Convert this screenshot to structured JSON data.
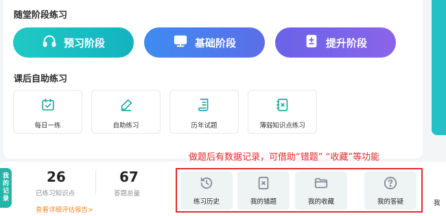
{
  "practice": {
    "section_title": "随堂阶段练习",
    "stages": [
      {
        "label": "预习阶段",
        "icon": "headphones-icon",
        "color_from": "#1fc9c4",
        "color_to": "#14b3bf"
      },
      {
        "label": "基础阶段",
        "icon": "monitor-icon",
        "color_from": "#3e8bf0",
        "color_to": "#5b6ee8"
      },
      {
        "label": "提升阶段",
        "icon": "badge-icon",
        "color_from": "#6a63e8",
        "color_to": "#8a64e9"
      }
    ]
  },
  "after_class": {
    "section_title": "课后自助练习",
    "tiles": [
      {
        "label": "每日一练",
        "icon": "calendar-check-icon"
      },
      {
        "label": "自助练习",
        "icon": "pencil-icon"
      },
      {
        "label": "历年试题",
        "icon": "scroll-icon"
      },
      {
        "label": "薄弱知识点练习",
        "icon": "notebook-x-icon"
      }
    ]
  },
  "records": {
    "tab_label": "我的记录",
    "stats": [
      {
        "value": "26",
        "label": "已练习知识点"
      },
      {
        "value": "67",
        "label": "答题总量"
      }
    ],
    "report_link": "查看详细评估报告>",
    "hint": "做题后有数据记录，可借助“错题”  “收藏”等功能",
    "items": [
      {
        "label": "练习历史",
        "icon": "history-icon"
      },
      {
        "label": "我的错题",
        "icon": "wrong-questions-icon"
      },
      {
        "label": "我的收藏",
        "icon": "folder-icon"
      },
      {
        "label": "我的答疑",
        "icon": "question-icon"
      }
    ],
    "partial_item": "我"
  },
  "colors": {
    "accent_teal": "#23c0c5",
    "icon_teal": "#1aa8a0",
    "highlight_red": "#e8262b",
    "link_orange": "#f08a24"
  }
}
